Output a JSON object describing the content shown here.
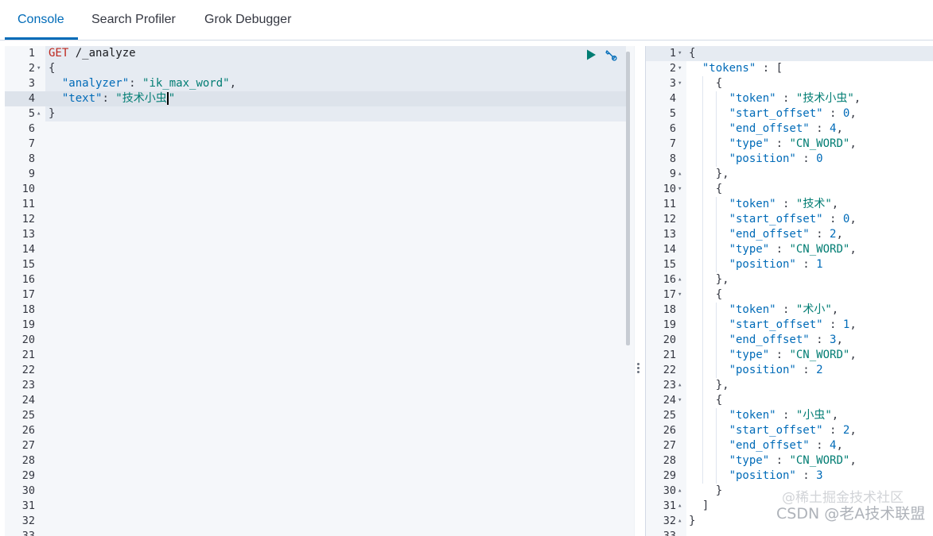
{
  "tabs": [
    {
      "label": "Console",
      "active": true
    },
    {
      "label": "Search Profiler",
      "active": false
    },
    {
      "label": "Grok Debugger",
      "active": false
    }
  ],
  "request": {
    "lines": [
      {
        "n": "1",
        "fold": "",
        "tokens": [
          [
            "method",
            "GET"
          ],
          [
            "url",
            " /_analyze"
          ]
        ]
      },
      {
        "n": "2",
        "fold": "▾",
        "tokens": [
          [
            "punc",
            "{"
          ]
        ]
      },
      {
        "n": "3",
        "fold": "",
        "tokens": [
          [
            "punc",
            "  "
          ],
          [
            "prop",
            "\"analyzer\""
          ],
          [
            "punc",
            ": "
          ],
          [
            "str",
            "\"ik_max_word\""
          ],
          [
            "punc",
            ","
          ]
        ]
      },
      {
        "n": "4",
        "fold": "",
        "tokens": [
          [
            "punc",
            "  "
          ],
          [
            "prop",
            "\"text\""
          ],
          [
            "punc",
            ": "
          ],
          [
            "str",
            "\"技术小虫"
          ],
          [
            "cursor",
            ""
          ],
          [
            "str",
            "\""
          ]
        ]
      },
      {
        "n": "5",
        "fold": "▴",
        "tokens": [
          [
            "punc",
            "}"
          ]
        ]
      },
      {
        "n": "6",
        "fold": "",
        "tokens": []
      },
      {
        "n": "7",
        "fold": "",
        "tokens": []
      },
      {
        "n": "8",
        "fold": "",
        "tokens": []
      },
      {
        "n": "9",
        "fold": "",
        "tokens": []
      },
      {
        "n": "10",
        "fold": "",
        "tokens": []
      },
      {
        "n": "11",
        "fold": "",
        "tokens": []
      },
      {
        "n": "12",
        "fold": "",
        "tokens": []
      },
      {
        "n": "13",
        "fold": "",
        "tokens": []
      },
      {
        "n": "14",
        "fold": "",
        "tokens": []
      },
      {
        "n": "15",
        "fold": "",
        "tokens": []
      },
      {
        "n": "16",
        "fold": "",
        "tokens": []
      },
      {
        "n": "17",
        "fold": "",
        "tokens": []
      },
      {
        "n": "18",
        "fold": "",
        "tokens": []
      },
      {
        "n": "19",
        "fold": "",
        "tokens": []
      },
      {
        "n": "20",
        "fold": "",
        "tokens": []
      },
      {
        "n": "21",
        "fold": "",
        "tokens": []
      },
      {
        "n": "22",
        "fold": "",
        "tokens": []
      },
      {
        "n": "23",
        "fold": "",
        "tokens": []
      },
      {
        "n": "24",
        "fold": "",
        "tokens": []
      },
      {
        "n": "25",
        "fold": "",
        "tokens": []
      },
      {
        "n": "26",
        "fold": "",
        "tokens": []
      },
      {
        "n": "27",
        "fold": "",
        "tokens": []
      },
      {
        "n": "28",
        "fold": "",
        "tokens": []
      },
      {
        "n": "29",
        "fold": "",
        "tokens": []
      },
      {
        "n": "30",
        "fold": "",
        "tokens": []
      },
      {
        "n": "31",
        "fold": "",
        "tokens": []
      },
      {
        "n": "32",
        "fold": "",
        "tokens": []
      },
      {
        "n": "33",
        "fold": "",
        "tokens": []
      }
    ],
    "actions": {
      "run_icon": "play-icon",
      "settings_icon": "wrench-icon"
    }
  },
  "response": {
    "lines": [
      {
        "n": "1",
        "fold": "▾",
        "tokens": [
          [
            "punc",
            "{"
          ]
        ]
      },
      {
        "n": "2",
        "fold": "▾",
        "tokens": [
          [
            "punc",
            "  "
          ],
          [
            "prop",
            "\"tokens\""
          ],
          [
            "punc",
            " : ["
          ]
        ]
      },
      {
        "n": "3",
        "fold": "▾",
        "tokens": [
          [
            "punc",
            "    {"
          ]
        ]
      },
      {
        "n": "4",
        "fold": "",
        "tokens": [
          [
            "punc",
            "      "
          ],
          [
            "prop",
            "\"token\""
          ],
          [
            "punc",
            " : "
          ],
          [
            "str",
            "\"技术小虫\""
          ],
          [
            "punc",
            ","
          ]
        ]
      },
      {
        "n": "5",
        "fold": "",
        "tokens": [
          [
            "punc",
            "      "
          ],
          [
            "prop",
            "\"start_offset\""
          ],
          [
            "punc",
            " : "
          ],
          [
            "num",
            "0"
          ],
          [
            "punc",
            ","
          ]
        ]
      },
      {
        "n": "6",
        "fold": "",
        "tokens": [
          [
            "punc",
            "      "
          ],
          [
            "prop",
            "\"end_offset\""
          ],
          [
            "punc",
            " : "
          ],
          [
            "num",
            "4"
          ],
          [
            "punc",
            ","
          ]
        ]
      },
      {
        "n": "7",
        "fold": "",
        "tokens": [
          [
            "punc",
            "      "
          ],
          [
            "prop",
            "\"type\""
          ],
          [
            "punc",
            " : "
          ],
          [
            "str",
            "\"CN_WORD\""
          ],
          [
            "punc",
            ","
          ]
        ]
      },
      {
        "n": "8",
        "fold": "",
        "tokens": [
          [
            "punc",
            "      "
          ],
          [
            "prop",
            "\"position\""
          ],
          [
            "punc",
            " : "
          ],
          [
            "num",
            "0"
          ]
        ]
      },
      {
        "n": "9",
        "fold": "▴",
        "tokens": [
          [
            "punc",
            "    },"
          ]
        ]
      },
      {
        "n": "10",
        "fold": "▾",
        "tokens": [
          [
            "punc",
            "    {"
          ]
        ]
      },
      {
        "n": "11",
        "fold": "",
        "tokens": [
          [
            "punc",
            "      "
          ],
          [
            "prop",
            "\"token\""
          ],
          [
            "punc",
            " : "
          ],
          [
            "str",
            "\"技术\""
          ],
          [
            "punc",
            ","
          ]
        ]
      },
      {
        "n": "12",
        "fold": "",
        "tokens": [
          [
            "punc",
            "      "
          ],
          [
            "prop",
            "\"start_offset\""
          ],
          [
            "punc",
            " : "
          ],
          [
            "num",
            "0"
          ],
          [
            "punc",
            ","
          ]
        ]
      },
      {
        "n": "13",
        "fold": "",
        "tokens": [
          [
            "punc",
            "      "
          ],
          [
            "prop",
            "\"end_offset\""
          ],
          [
            "punc",
            " : "
          ],
          [
            "num",
            "2"
          ],
          [
            "punc",
            ","
          ]
        ]
      },
      {
        "n": "14",
        "fold": "",
        "tokens": [
          [
            "punc",
            "      "
          ],
          [
            "prop",
            "\"type\""
          ],
          [
            "punc",
            " : "
          ],
          [
            "str",
            "\"CN_WORD\""
          ],
          [
            "punc",
            ","
          ]
        ]
      },
      {
        "n": "15",
        "fold": "",
        "tokens": [
          [
            "punc",
            "      "
          ],
          [
            "prop",
            "\"position\""
          ],
          [
            "punc",
            " : "
          ],
          [
            "num",
            "1"
          ]
        ]
      },
      {
        "n": "16",
        "fold": "▴",
        "tokens": [
          [
            "punc",
            "    },"
          ]
        ]
      },
      {
        "n": "17",
        "fold": "▾",
        "tokens": [
          [
            "punc",
            "    {"
          ]
        ]
      },
      {
        "n": "18",
        "fold": "",
        "tokens": [
          [
            "punc",
            "      "
          ],
          [
            "prop",
            "\"token\""
          ],
          [
            "punc",
            " : "
          ],
          [
            "str",
            "\"术小\""
          ],
          [
            "punc",
            ","
          ]
        ]
      },
      {
        "n": "19",
        "fold": "",
        "tokens": [
          [
            "punc",
            "      "
          ],
          [
            "prop",
            "\"start_offset\""
          ],
          [
            "punc",
            " : "
          ],
          [
            "num",
            "1"
          ],
          [
            "punc",
            ","
          ]
        ]
      },
      {
        "n": "20",
        "fold": "",
        "tokens": [
          [
            "punc",
            "      "
          ],
          [
            "prop",
            "\"end_offset\""
          ],
          [
            "punc",
            " : "
          ],
          [
            "num",
            "3"
          ],
          [
            "punc",
            ","
          ]
        ]
      },
      {
        "n": "21",
        "fold": "",
        "tokens": [
          [
            "punc",
            "      "
          ],
          [
            "prop",
            "\"type\""
          ],
          [
            "punc",
            " : "
          ],
          [
            "str",
            "\"CN_WORD\""
          ],
          [
            "punc",
            ","
          ]
        ]
      },
      {
        "n": "22",
        "fold": "",
        "tokens": [
          [
            "punc",
            "      "
          ],
          [
            "prop",
            "\"position\""
          ],
          [
            "punc",
            " : "
          ],
          [
            "num",
            "2"
          ]
        ]
      },
      {
        "n": "23",
        "fold": "▴",
        "tokens": [
          [
            "punc",
            "    },"
          ]
        ]
      },
      {
        "n": "24",
        "fold": "▾",
        "tokens": [
          [
            "punc",
            "    {"
          ]
        ]
      },
      {
        "n": "25",
        "fold": "",
        "tokens": [
          [
            "punc",
            "      "
          ],
          [
            "prop",
            "\"token\""
          ],
          [
            "punc",
            " : "
          ],
          [
            "str",
            "\"小虫\""
          ],
          [
            "punc",
            ","
          ]
        ]
      },
      {
        "n": "26",
        "fold": "",
        "tokens": [
          [
            "punc",
            "      "
          ],
          [
            "prop",
            "\"start_offset\""
          ],
          [
            "punc",
            " : "
          ],
          [
            "num",
            "2"
          ],
          [
            "punc",
            ","
          ]
        ]
      },
      {
        "n": "27",
        "fold": "",
        "tokens": [
          [
            "punc",
            "      "
          ],
          [
            "prop",
            "\"end_offset\""
          ],
          [
            "punc",
            " : "
          ],
          [
            "num",
            "4"
          ],
          [
            "punc",
            ","
          ]
        ]
      },
      {
        "n": "28",
        "fold": "",
        "tokens": [
          [
            "punc",
            "      "
          ],
          [
            "prop",
            "\"type\""
          ],
          [
            "punc",
            " : "
          ],
          [
            "str",
            "\"CN_WORD\""
          ],
          [
            "punc",
            ","
          ]
        ]
      },
      {
        "n": "29",
        "fold": "",
        "tokens": [
          [
            "punc",
            "      "
          ],
          [
            "prop",
            "\"position\""
          ],
          [
            "punc",
            " : "
          ],
          [
            "num",
            "3"
          ]
        ]
      },
      {
        "n": "30",
        "fold": "▴",
        "tokens": [
          [
            "punc",
            "    }"
          ]
        ]
      },
      {
        "n": "31",
        "fold": "▴",
        "tokens": [
          [
            "punc",
            "  ]"
          ]
        ]
      },
      {
        "n": "32",
        "fold": "▴",
        "tokens": [
          [
            "punc",
            "}"
          ]
        ]
      },
      {
        "n": "33",
        "fold": "",
        "tokens": []
      }
    ]
  },
  "watermark": "CSDN @老A技术联盟",
  "watermark_overlay": "@稀土掘金技术社区",
  "colors": {
    "accent": "#006bb8",
    "method": "#bd271e",
    "string": "#017d73",
    "property": "#006bb8"
  }
}
